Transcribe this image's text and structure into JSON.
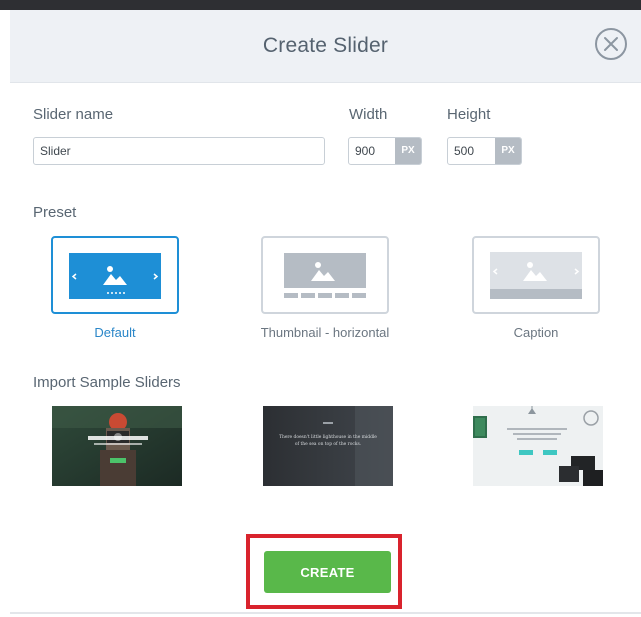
{
  "dialog": {
    "title": "Create Slider",
    "close_icon": "close-icon"
  },
  "form": {
    "slider_name_label": "Slider name",
    "slider_name_value": "Slider",
    "width_label": "Width",
    "width_value": "900",
    "width_unit": "PX",
    "height_label": "Height",
    "height_value": "500",
    "height_unit": "PX"
  },
  "preset": {
    "label": "Preset",
    "options": [
      {
        "label": "Default",
        "selected": true,
        "icon": "default-layout-icon"
      },
      {
        "label": "Thumbnail - horizontal",
        "selected": false,
        "icon": "thumbnail-layout-icon"
      },
      {
        "label": "Caption",
        "selected": false,
        "icon": "caption-layout-icon"
      }
    ]
  },
  "samples": {
    "label": "Import Sample Sliders",
    "items": [
      {
        "title": "",
        "thumb_text": ""
      },
      {
        "title": "",
        "thumb_text": "There doesn't little lighthouse in the middle of the sea on top of the rocks."
      },
      {
        "title": "",
        "thumb_text": ""
      }
    ]
  },
  "actions": {
    "create_label": "CREATE"
  },
  "colors": {
    "accent_blue": "#1e8fd6",
    "create_green": "#59b84a",
    "highlight_red": "#d9232d",
    "header_bg": "#eef1f5"
  }
}
